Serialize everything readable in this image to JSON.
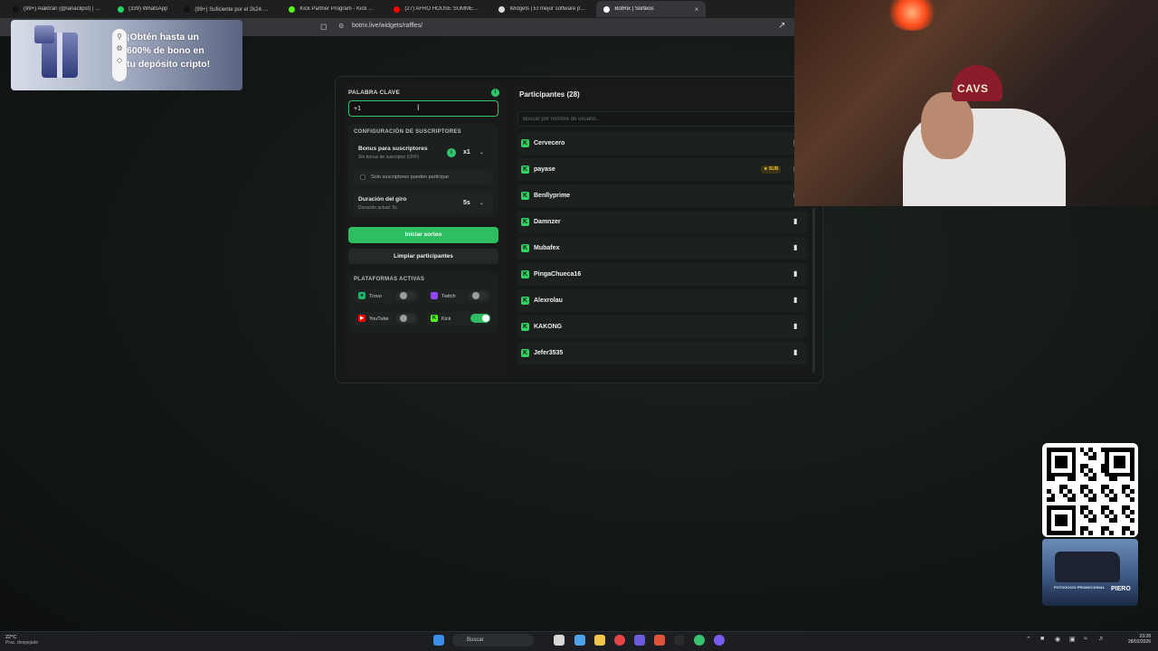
{
  "browser": {
    "tabs": [
      {
        "label": "(99+) Alaktran (@lanaclipst) | TikTok",
        "color": "#111111"
      },
      {
        "label": "(339) WhatsApp",
        "color": "#25d366"
      },
      {
        "label": "(99+) Suficiente por el 2k24 😎 #fivem",
        "color": "#111111"
      },
      {
        "label": "Kick Partner Program - Kick Dashboard",
        "color": "#53fc18"
      },
      {
        "label": "(27) AFRO HOUSE SUMMER MIX",
        "color": "#ff0000"
      },
      {
        "label": "Widgets | El mejor software para po",
        "color": "#dddddd"
      },
      {
        "label": "BotRix | Sorteos",
        "color": "#ffffff",
        "active": true
      }
    ],
    "url": "botrix.live/widgets/raffles/"
  },
  "promo": {
    "line1": "¡Obtén hasta un",
    "line2": "600% de bono en",
    "line3": "tu depósito cripto!"
  },
  "raffle": {
    "keyword_label": "PALABRA CLAVE",
    "keyword_value": "+1",
    "subs_section_title": "CONFIGURACIÓN DE SUSCRIPTORES",
    "subs_bonus_title": "Bonus para suscriptores",
    "subs_bonus_sub": "Sin bonus de suscriptor (OFF)",
    "subs_bonus_value": "x1",
    "only_subs_label": "Solo suscriptores pueden participar",
    "only_subs_checked": false,
    "spin_title": "Duración del giro",
    "spin_sub": "Duración actual: 5s",
    "spin_value": "5s",
    "start_button": "Iniciar sorteo",
    "clear_button": "Limpiar participantes",
    "platforms_title": "PLATAFORMAS ACTIVAS",
    "platforms": [
      {
        "name": "Trovo",
        "enabled": false,
        "color": "#1bb56d"
      },
      {
        "name": "Twitch",
        "enabled": false,
        "color": "#9146ff"
      },
      {
        "name": "YouTube",
        "enabled": false,
        "color": "#ff0000"
      },
      {
        "name": "Kick",
        "enabled": true,
        "color": "#53fc18"
      }
    ]
  },
  "participants": {
    "title": "Participantes (28)",
    "search_placeholder": "Buscar por nombre de usuario...",
    "sub_badge": "★ SUB",
    "items": [
      {
        "name": "Cervecero",
        "sub": false
      },
      {
        "name": "payase",
        "sub": true
      },
      {
        "name": "Benllyprime",
        "sub": false
      },
      {
        "name": "Damnzer",
        "sub": false
      },
      {
        "name": "Mubafex",
        "sub": false
      },
      {
        "name": "PingaChueca16",
        "sub": false
      },
      {
        "name": "Alexrolau",
        "sub": false
      },
      {
        "name": "KAKONG",
        "sub": false
      },
      {
        "name": "Jefer3535",
        "sub": false
      }
    ]
  },
  "webcam": {
    "cap_text": "CAVS"
  },
  "car_promo": {
    "caption_left": "POTOGOCIO PROMOCIONAL",
    "caption_right": "PIERO"
  },
  "taskbar": {
    "weather_temp": "22°C",
    "weather_desc": "Prac. despejado",
    "search_label": "Buscar",
    "time": "23:28",
    "date": "28/02/2026"
  }
}
